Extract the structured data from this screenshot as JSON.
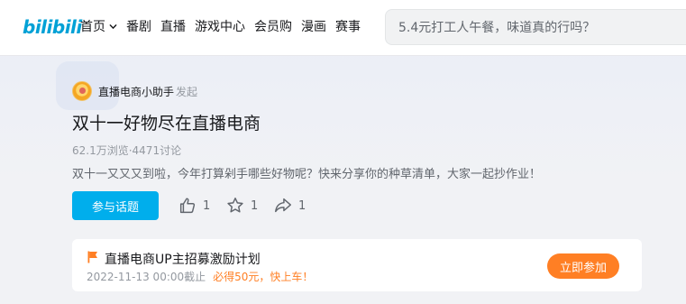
{
  "header": {
    "logo": "bilibili",
    "nav": [
      {
        "label": "首页",
        "has_dropdown": true
      },
      {
        "label": "番剧"
      },
      {
        "label": "直播"
      },
      {
        "label": "游戏中心"
      },
      {
        "label": "会员购"
      },
      {
        "label": "漫画"
      },
      {
        "label": "赛事"
      }
    ],
    "search": {
      "placeholder": "5.4元打工人午餐，味道真的行吗？"
    }
  },
  "topic": {
    "creator_name": "直播电商小助手",
    "creator_suffix": "发起",
    "title": "双十一好物尽在直播电商",
    "stats": "62.1万浏览·4471讨论",
    "description": "双十一又又又到啦，今年打算剁手哪些好物呢？快来分享你的种草清单，大家一起抄作业！",
    "join_label": "参与话题",
    "actions": {
      "like": {
        "icon": "thumbs-up-icon",
        "count": "1"
      },
      "favorite": {
        "icon": "star-icon",
        "count": "1"
      },
      "share": {
        "icon": "share-icon",
        "count": "1"
      }
    }
  },
  "incentive": {
    "icon": "flag-icon",
    "title": "直播电商UP主招募激励计划",
    "deadline": "2022-11-13 00:00截止",
    "reward": "必得50元，快上车！",
    "button_label": "立即参加"
  },
  "colors": {
    "brand_blue": "#00aeec",
    "accent_orange": "#ff7f24",
    "text_primary": "#18191c",
    "text_secondary": "#9499a0"
  }
}
